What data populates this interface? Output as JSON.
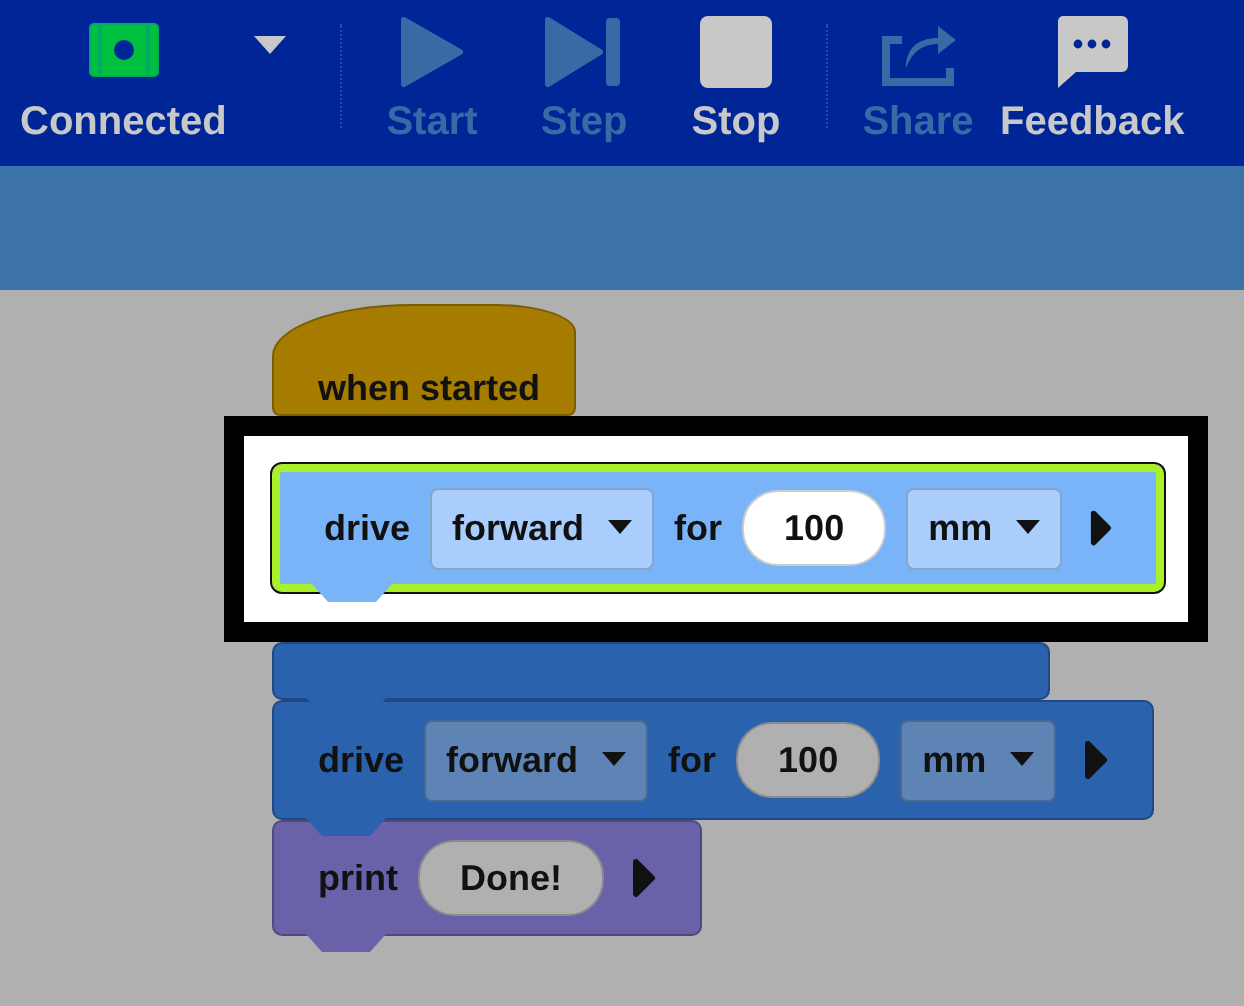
{
  "toolbar": {
    "connection": {
      "label": "Connected",
      "connected": true
    },
    "groups": [
      [
        {
          "kind": "start",
          "label": "Start",
          "disabled": true
        },
        {
          "kind": "step",
          "label": "Step",
          "disabled": true
        },
        {
          "kind": "stop",
          "label": "Stop",
          "disabled": false
        }
      ],
      [
        {
          "kind": "share",
          "label": "Share",
          "disabled": true
        },
        {
          "kind": "feedback",
          "label": "Feedback",
          "disabled": false
        }
      ]
    ]
  },
  "blocks": [
    {
      "kind": "hat",
      "highlighted": false,
      "parts": [
        {
          "kind": "label",
          "text": "when started"
        }
      ]
    },
    {
      "kind": "motion",
      "highlighted": true,
      "parts": [
        {
          "kind": "label",
          "text": "drive"
        },
        {
          "kind": "dropdown",
          "text": "forward"
        },
        {
          "kind": "label",
          "text": "for"
        },
        {
          "kind": "number",
          "text": "100"
        },
        {
          "kind": "dropdown",
          "text": "mm"
        },
        {
          "kind": "arrow"
        }
      ]
    },
    {
      "kind": "motion",
      "highlighted": false
    },
    {
      "kind": "motion",
      "highlighted": false,
      "parts": [
        {
          "kind": "label",
          "text": "drive"
        },
        {
          "kind": "dropdown",
          "text": "forward"
        },
        {
          "kind": "label",
          "text": "for"
        },
        {
          "kind": "number",
          "text": "100"
        },
        {
          "kind": "dropdown",
          "text": "mm"
        },
        {
          "kind": "arrow"
        }
      ]
    },
    {
      "kind": "looks",
      "highlighted": false,
      "parts": [
        {
          "kind": "label",
          "text": "print"
        },
        {
          "kind": "number",
          "text": "Done!"
        },
        {
          "kind": "arrow"
        }
      ]
    }
  ]
}
